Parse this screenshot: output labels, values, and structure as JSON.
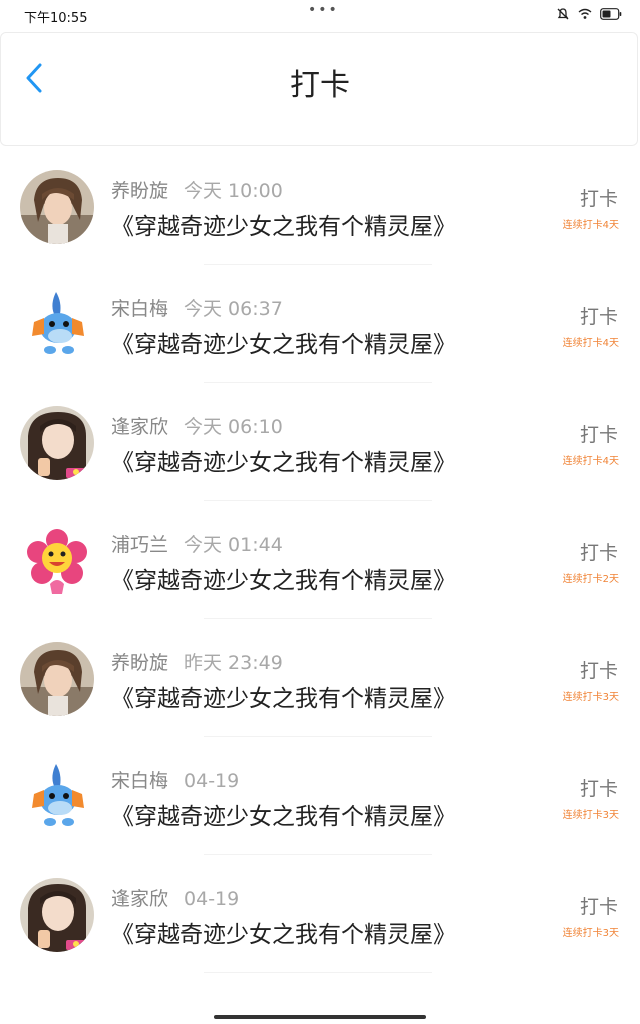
{
  "status": {
    "time": "下午10:55",
    "dots": "•••"
  },
  "header": {
    "title": "打卡"
  },
  "items": [
    {
      "name": "养盼旋",
      "time": "今天 10:00",
      "title": "《穿越奇迹少女之我有个精灵屋》",
      "button": "打卡",
      "streak": "连续打卡4天",
      "avatar": "boy"
    },
    {
      "name": "宋白梅",
      "time": "今天 06:37",
      "title": "《穿越奇迹少女之我有个精灵屋》",
      "button": "打卡",
      "streak": "连续打卡4天",
      "avatar": "mudkip"
    },
    {
      "name": "逢家欣",
      "time": "今天 06:10",
      "title": "《穿越奇迹少女之我有个精灵屋》",
      "button": "打卡",
      "streak": "连续打卡4天",
      "avatar": "girl"
    },
    {
      "name": "浦巧兰",
      "time": "今天 01:44",
      "title": "《穿越奇迹少女之我有个精灵屋》",
      "button": "打卡",
      "streak": "连续打卡2天",
      "avatar": "flower"
    },
    {
      "name": "养盼旋",
      "time": "昨天 23:49",
      "title": "《穿越奇迹少女之我有个精灵屋》",
      "button": "打卡",
      "streak": "连续打卡3天",
      "avatar": "boy"
    },
    {
      "name": "宋白梅",
      "time": "04-19",
      "title": "《穿越奇迹少女之我有个精灵屋》",
      "button": "打卡",
      "streak": "连续打卡3天",
      "avatar": "mudkip"
    },
    {
      "name": "逢家欣",
      "time": "04-19",
      "title": "《穿越奇迹少女之我有个精灵屋》",
      "button": "打卡",
      "streak": "连续打卡3天",
      "avatar": "girl"
    }
  ]
}
